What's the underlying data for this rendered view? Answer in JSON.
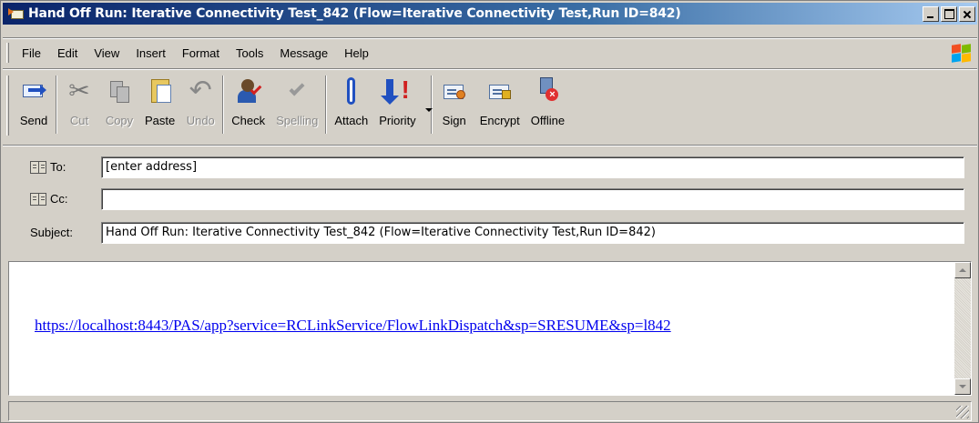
{
  "window": {
    "title": "Hand Off Run: Iterative Connectivity Test_842 (Flow=Iterative Connectivity Test,Run ID=842)"
  },
  "menu": {
    "items": [
      {
        "label": "File"
      },
      {
        "label": "Edit"
      },
      {
        "label": "View"
      },
      {
        "label": "Insert"
      },
      {
        "label": "Format"
      },
      {
        "label": "Tools"
      },
      {
        "label": "Message"
      },
      {
        "label": "Help"
      }
    ]
  },
  "toolbar": {
    "send": {
      "label": "Send",
      "icon": "send-icon"
    },
    "cut": {
      "label": "Cut",
      "icon": "scissors-icon",
      "disabled": true
    },
    "copy": {
      "label": "Copy",
      "icon": "copy-icon",
      "disabled": true
    },
    "paste": {
      "label": "Paste",
      "icon": "paste-icon"
    },
    "undo": {
      "label": "Undo",
      "icon": "undo-icon",
      "disabled": true
    },
    "check": {
      "label": "Check",
      "icon": "check-names-icon"
    },
    "spelling": {
      "label": "Spelling",
      "icon": "spelling-icon",
      "disabled": true
    },
    "attach": {
      "label": "Attach",
      "icon": "paperclip-icon"
    },
    "priority": {
      "label": "Priority",
      "icon": "priority-icon"
    },
    "sign": {
      "label": "Sign",
      "icon": "sign-icon"
    },
    "encrypt": {
      "label": "Encrypt",
      "icon": "encrypt-icon"
    },
    "offline": {
      "label": "Offline",
      "icon": "offline-icon"
    }
  },
  "header": {
    "to": {
      "label": "To:",
      "value": "[enter address]"
    },
    "cc": {
      "label": "Cc:",
      "value": ""
    },
    "subject": {
      "label": "Subject:",
      "value": "Hand Off Run: Iterative Connectivity Test_842 (Flow=Iterative Connectivity Test,Run ID=842)"
    }
  },
  "body": {
    "link": "https://localhost:8443/PAS/app?service=RCLinkService/FlowLinkDispatch&sp=SRESUME&sp=l842"
  },
  "colors": {
    "titlebar_start": "#0a246a",
    "titlebar_end": "#a6caf0",
    "chrome": "#d4d0c8",
    "link": "#0000ee"
  }
}
